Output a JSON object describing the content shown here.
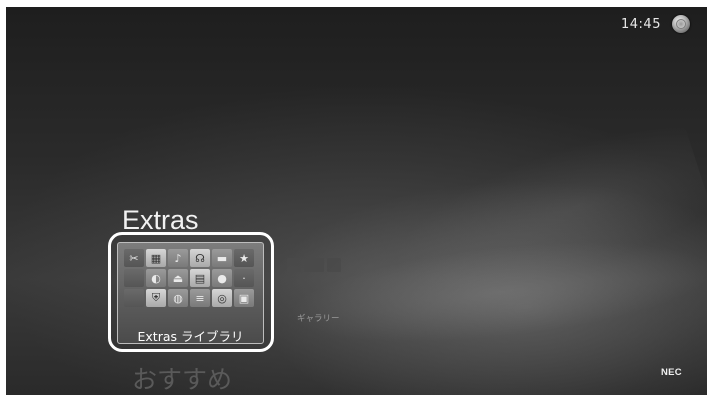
{
  "status_bar": {
    "time": "14:45",
    "icon": "media-center-orb-icon"
  },
  "section": {
    "title": "Extras",
    "next_title": "おすすめ"
  },
  "focused_tile": {
    "label": "Extras ライブラリ",
    "grid_icons": [
      "scissors-icon",
      "chart-grid-icon",
      "music-note-icon",
      "plug-icon",
      "bar-icon",
      "star-icon",
      "blank-icon",
      "shopping-bag-icon",
      "disc-tray-icon",
      "notes-icon",
      "sphere-icon",
      "dot-icon",
      "blank-icon",
      "shield-icon",
      "globe-icon",
      "toolbar-icon",
      "cd-icon",
      "monitor-icon"
    ]
  },
  "side_tile": {
    "label": "ギャラリー"
  },
  "brand": {
    "logo": "NEC"
  },
  "colors": {
    "accent": "#ffffff",
    "background": "#2b2b2b"
  }
}
